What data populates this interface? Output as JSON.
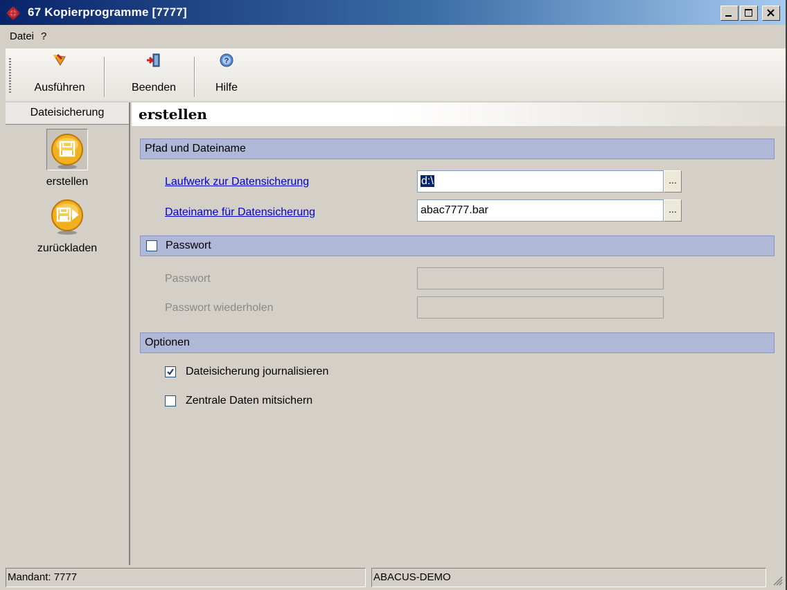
{
  "window": {
    "title": "67 Kopierprogramme [7777]",
    "colors": {
      "titlebar_start": "#0a246a",
      "titlebar_end": "#a6caf0",
      "group_header": "#b0b8d8"
    }
  },
  "menu": {
    "items": [
      "Datei",
      "?"
    ]
  },
  "toolbar": {
    "run_label": "Ausführen",
    "exit_label": "Beenden",
    "help_label": "Hilfe"
  },
  "nav": {
    "header": "Dateisicherung",
    "items": [
      {
        "label": "erstellen",
        "icon": "floppy-disk-icon",
        "selected": true
      },
      {
        "label": "zurückladen",
        "icon": "floppy-restore-icon",
        "selected": false
      }
    ]
  },
  "main": {
    "title": "erstellen",
    "path_group": {
      "header": "Pfad und Dateiname",
      "drive_label": "Laufwerk zur Datensicherung",
      "drive_value": "d:\\",
      "filename_label": "Dateiname für Datensicherung",
      "filename_value": "abac7777.bar",
      "browse_label": "..."
    },
    "password_group": {
      "header": "Passwort",
      "enabled": false,
      "password_label": "Passwort",
      "password_value": "",
      "repeat_label": "Passwort wiederholen",
      "repeat_value": ""
    },
    "options_group": {
      "header": "Optionen",
      "journal_label": "Dateisicherung journalisieren",
      "journal_checked": true,
      "central_label": "Zentrale Daten mitsichern",
      "central_checked": false
    }
  },
  "status": {
    "mandant": "Mandant: 7777",
    "company": "ABACUS-DEMO"
  }
}
